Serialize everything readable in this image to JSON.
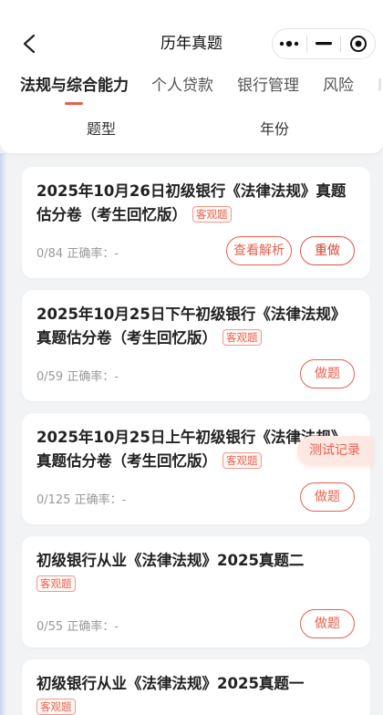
{
  "nav": {
    "title": "历年真题"
  },
  "tabs": [
    {
      "label": "法规与综合能力",
      "active": true
    },
    {
      "label": "个人贷款",
      "active": false
    },
    {
      "label": "银行管理",
      "active": false
    },
    {
      "label": "风险",
      "active": false
    }
  ],
  "filters": [
    {
      "label": "题型"
    },
    {
      "label": "年份"
    }
  ],
  "papers": [
    {
      "title": "2025年10月26日初级银行《法律法规》真题估分卷（考生回忆版）",
      "tag": "客观题",
      "progress": "0/84 正确率：-",
      "buttons": [
        "查看解析",
        "重做"
      ]
    },
    {
      "title": "2025年10月25日下午初级银行《法律法规》真题估分卷（考生回忆版）",
      "tag": "客观题",
      "progress": "0/59 正确率：-",
      "buttons": [
        "做题"
      ]
    },
    {
      "title": "2025年10月25日上午初级银行《法律法规》真题估分卷（考生回忆版）",
      "tag": "客观题",
      "progress": "0/125 正确率：-",
      "buttons": [
        "做题"
      ]
    },
    {
      "title": "初级银行从业《法律法规》2025真题二",
      "tag": "客观题",
      "progress": "0/55 正确率：-",
      "buttons": [
        "做题"
      ]
    },
    {
      "title": "初级银行从业《法律法规》2025真题一",
      "tag": "客观题",
      "progress": "",
      "buttons": []
    }
  ],
  "floating": {
    "record_label": "测试记录"
  },
  "colors": {
    "accent": "#e8604c",
    "background": "#f2f3f5",
    "card": "#ffffff"
  },
  "icons": {
    "back": "chevron-left-icon",
    "more": "more-dots-icon",
    "minimize": "minimize-icon",
    "close": "target-circle-icon"
  }
}
